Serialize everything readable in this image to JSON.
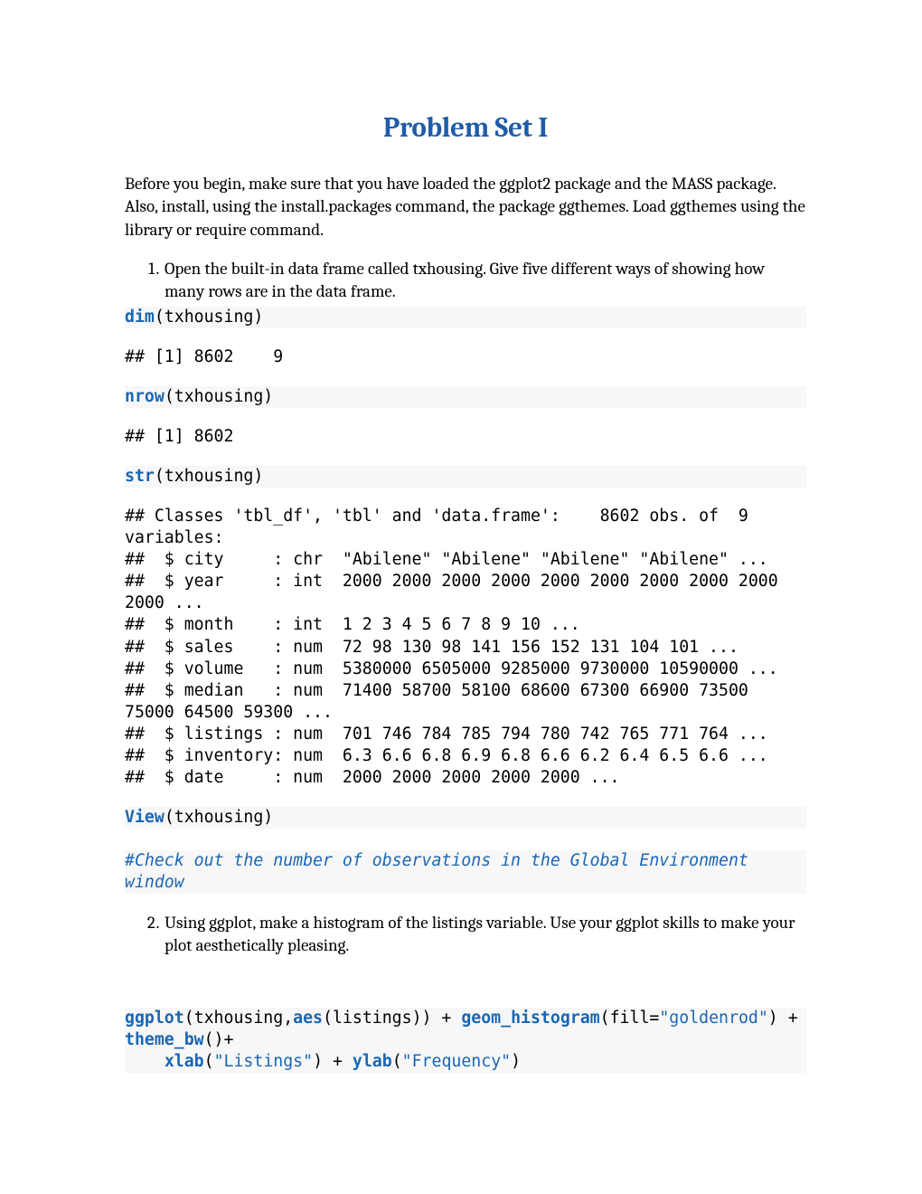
{
  "title": "Problem Set I",
  "intro": "Before you begin, make sure that you have loaded the ggplot2 package and the MASS package. Also, install, using the install.packages command, the package ggthemes. Load ggthemes using the library or require command.",
  "q1": "Open the built-in data frame called txhousing. Give five different ways of showing how many rows are in the data frame.",
  "q2": "Using ggplot, make a histogram of the listings variable. Use your ggplot skills to make your plot aesthetically pleasing.",
  "code": {
    "dim_fn": "dim",
    "dim_arg": "(txhousing)",
    "dim_out": "## [1] 8602    9",
    "nrow_fn": "nrow",
    "nrow_arg": "(txhousing)",
    "nrow_out": "## [1] 8602",
    "str_fn": "str",
    "str_arg": "(txhousing)",
    "str_out": "## Classes 'tbl_df', 'tbl' and 'data.frame':    8602 obs. of  9 variables:\n##  $ city     : chr  \"Abilene\" \"Abilene\" \"Abilene\" \"Abilene\" ...\n##  $ year     : int  2000 2000 2000 2000 2000 2000 2000 2000 2000 2000 ...\n##  $ month    : int  1 2 3 4 5 6 7 8 9 10 ...\n##  $ sales    : num  72 98 130 98 141 156 152 131 104 101 ...\n##  $ volume   : num  5380000 6505000 9285000 9730000 10590000 ...\n##  $ median   : num  71400 58700 58100 68600 67300 66900 73500 75000 64500 59300 ...\n##  $ listings : num  701 746 784 785 794 780 742 765 771 764 ...\n##  $ inventory: num  6.3 6.6 6.8 6.9 6.8 6.6 6.2 6.4 6.5 6.6 ...\n##  $ date     : num  2000 2000 2000 2000 2000 ...",
    "view_fn": "View",
    "view_arg": "(txhousing)",
    "comment": "#Check out the number of observations in the Global Environment window",
    "gg_fn1": "ggplot",
    "gg_a1": "(txhousing,",
    "gg_fn2": "aes",
    "gg_a2": "(listings)) + ",
    "gg_fn3": "geom_histogram",
    "gg_a3": "(fill=",
    "gg_s3": "\"goldenrod\"",
    "gg_a3b": ") + ",
    "gg_fn4": "theme_bw",
    "gg_a4": "()+",
    "gg_spacer": "    ",
    "gg_fn5": "xlab",
    "gg_a5": "(",
    "gg_s5": "\"Listings\"",
    "gg_a5b": ") + ",
    "gg_fn6": "ylab",
    "gg_a6": "(",
    "gg_s6": "\"Frequency\"",
    "gg_a6b": ")"
  }
}
